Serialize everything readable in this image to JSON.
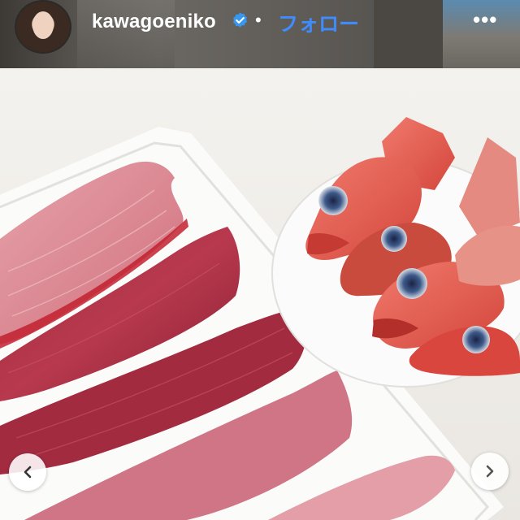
{
  "header": {
    "username": "kawagoeniko",
    "verified_icon": "verified-badge-icon",
    "separator": "•",
    "follow_label": "フォロー",
    "more_label": "•••",
    "follow_color": "#3f8cff",
    "verified_color": "#3897f0"
  },
  "post": {
    "prev_icon": "chevron-left-icon",
    "next_icon": "chevron-right-icon"
  }
}
